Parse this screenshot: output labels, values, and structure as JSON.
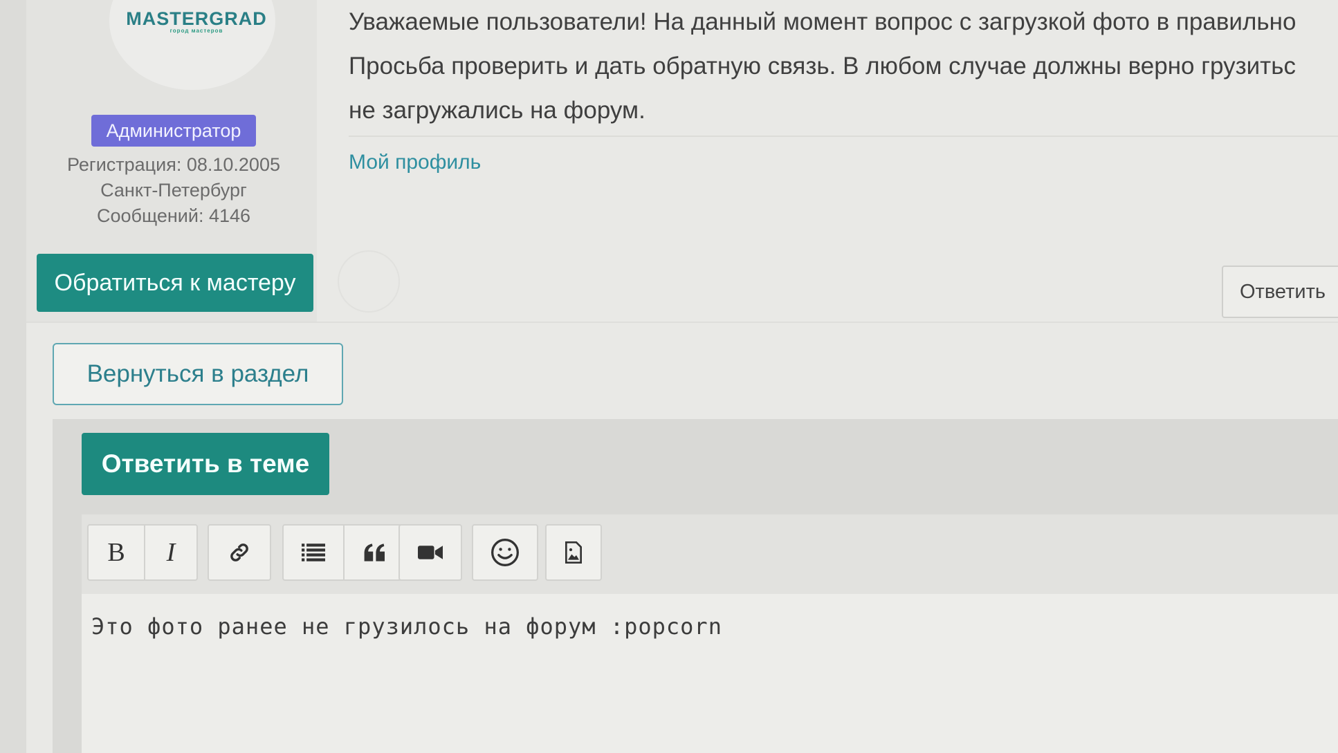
{
  "author": {
    "logo": {
      "name": "MASTERGRAD",
      "tagline": "город мастеров"
    },
    "role": "Администратор",
    "registration": "Регистрация: 08.10.2005",
    "city": "Санкт-Петербург",
    "messages": "Сообщений: 4146",
    "contact_button": "Обратиться к мастеру"
  },
  "post": {
    "lines": [
      "Уважаемые пользователи! На данный момент вопрос с загрузкой фото в правильно",
      "Просьба проверить и дать обратную связь. В любом случае должны верно грузитьс",
      "не загружались на форум."
    ],
    "profile_link": "Мой профиль",
    "reply_button": "Ответить"
  },
  "back_button": "Вернуться в раздел",
  "editor": {
    "reply_theme_button": "Ответить в теме",
    "toolbar": {
      "bold": "B",
      "italic": "I",
      "icons": [
        "link-icon",
        "list-icon",
        "quote-icon",
        "video-icon",
        "smiley-icon",
        "image-icon"
      ]
    },
    "text": "Это фото ранее не грузилось на форум :popcorn"
  },
  "colors": {
    "accent_teal": "#1e8c82",
    "link": "#2e8fa0",
    "badge": "#6f6dd8"
  }
}
